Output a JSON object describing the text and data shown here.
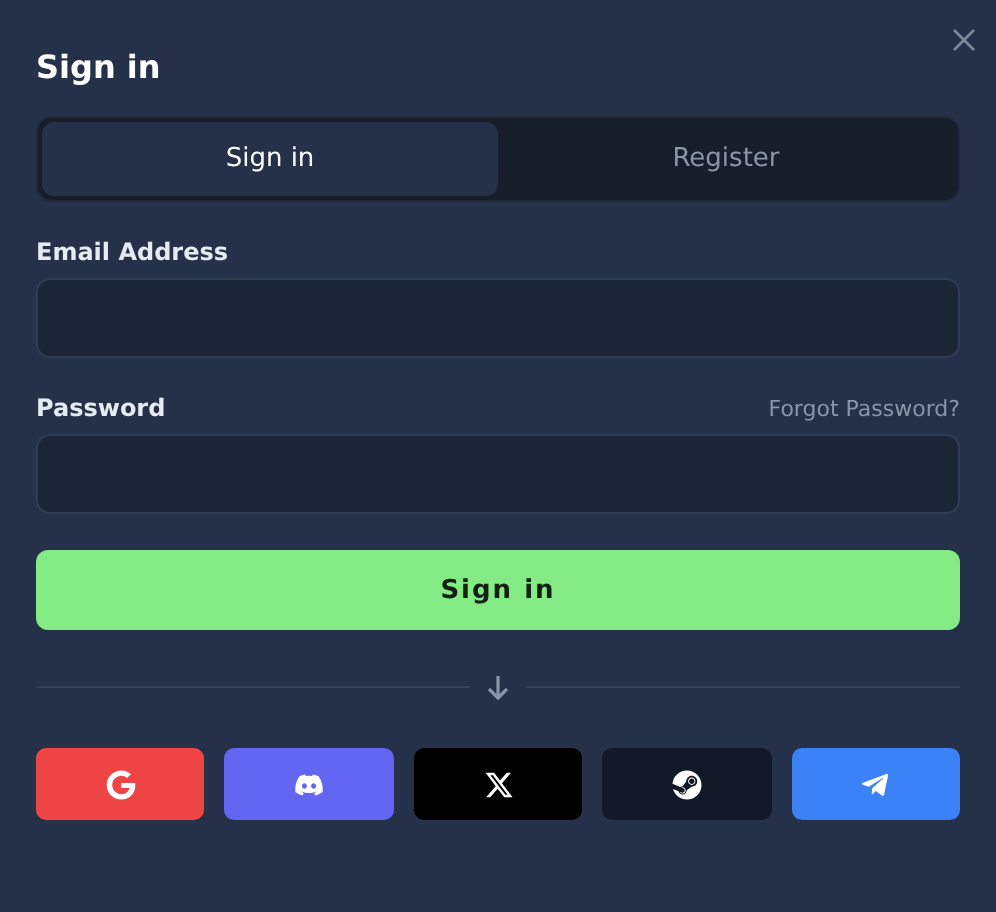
{
  "dialog": {
    "title": "Sign in"
  },
  "tabs": [
    {
      "label": "Sign in",
      "selected": true
    },
    {
      "label": "Register",
      "selected": false
    }
  ],
  "fields": [
    {
      "label": "Email Address"
    },
    {
      "label": "Password",
      "link": "Forgot Password?"
    }
  ],
  "submit": {
    "label": "Sign in"
  },
  "social_buttons": [
    {
      "kind": "google",
      "color": "#ef4444"
    },
    {
      "kind": "discord",
      "color": "#6366f1"
    },
    {
      "kind": "x",
      "color": "#000000"
    },
    {
      "kind": "steam",
      "color": "#111827"
    },
    {
      "kind": "telegram",
      "color": "#3b82f6"
    }
  ]
}
